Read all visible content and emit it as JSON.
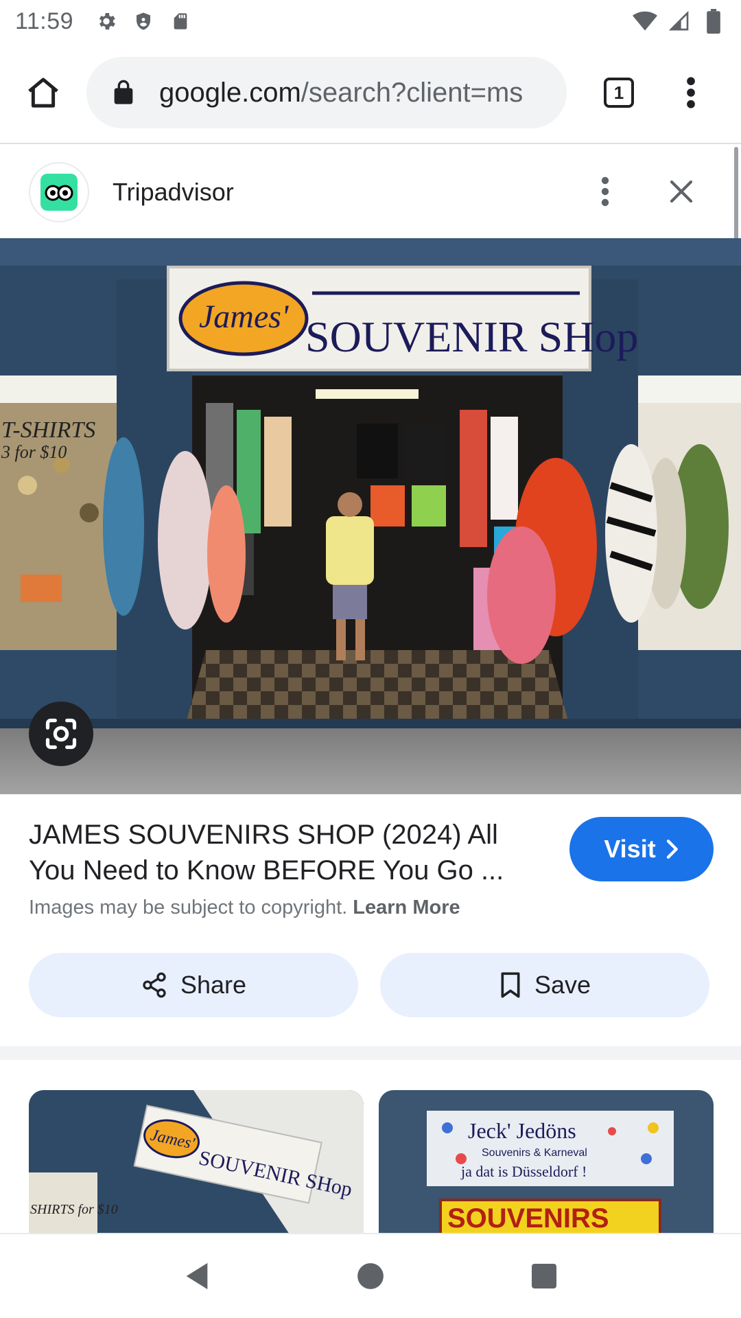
{
  "status_bar": {
    "time": "11:59",
    "icons": [
      "gear-icon",
      "shield-icon",
      "sd-card-icon",
      "wifi-icon",
      "signal-icon",
      "battery-icon"
    ]
  },
  "browser": {
    "url_domain": "google.com",
    "url_path": "/search?client=ms",
    "tab_count": "1"
  },
  "source": {
    "name": "Tripadvisor",
    "brand_color": "#34e0a1"
  },
  "main_image": {
    "sign_name": "James'",
    "sign_text": "SOUVENIR SHop",
    "window_sign": "T-SHIRTS 3 for $10"
  },
  "result": {
    "title": "JAMES SOUVENIRS SHOP (2024) All You Need to Know BEFORE You Go ...",
    "visit_label": "Visit",
    "copyright_text": "Images may be subject to copyright.",
    "learn_more": "Learn More"
  },
  "actions": {
    "share_label": "Share",
    "save_label": "Save"
  },
  "related": [
    {
      "sign_name": "James'",
      "sign_text": "SOUVENIR SHop",
      "window_text": "SHIRTS for $10"
    },
    {
      "sign_line1": "Jeck' Jedöns",
      "sign_line2": "Souvenirs & Karneval",
      "sign_line3": "ja dat is Düsseldorf !",
      "banner": "SOUVENIRS"
    }
  ],
  "colors": {
    "accent": "#1a73e8",
    "chip_bg": "#e8f0fe",
    "storefront": "#2f4a66"
  }
}
